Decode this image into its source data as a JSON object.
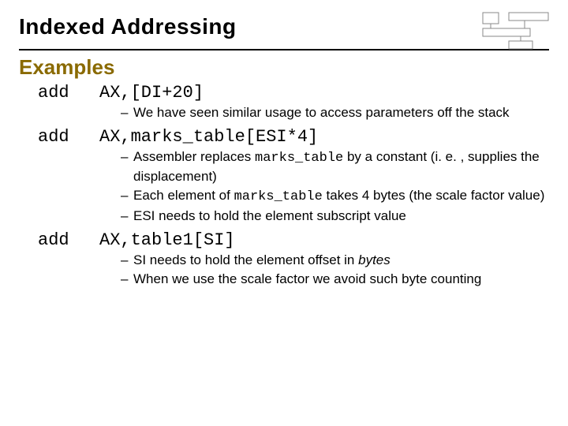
{
  "title": "Indexed Addressing",
  "subhead": "Examples",
  "items": [
    {
      "opcode": "add",
      "operands": "AX,[DI+20]",
      "bullets": [
        {
          "text": "We have seen similar usage to access parameters off the stack"
        }
      ]
    },
    {
      "opcode": "add",
      "operands": "AX,marks_table[ESI*4]",
      "bullets": [
        {
          "pre": "Assembler replaces ",
          "mono": "marks_table",
          "post": " by a constant (i. e. , supplies the displacement)"
        },
        {
          "pre": "Each element of ",
          "mono": "marks_table",
          "post": " takes 4 bytes (the scale factor value)"
        },
        {
          "text": "ESI needs to hold the element subscript value"
        }
      ]
    },
    {
      "opcode": "add",
      "operands": "AX,table1[SI]",
      "bullets": [
        {
          "pre": "SI needs to hold the element offset in ",
          "ital": "bytes",
          "post": ""
        },
        {
          "text": "When we use the scale factor we avoid such byte counting"
        }
      ]
    }
  ]
}
